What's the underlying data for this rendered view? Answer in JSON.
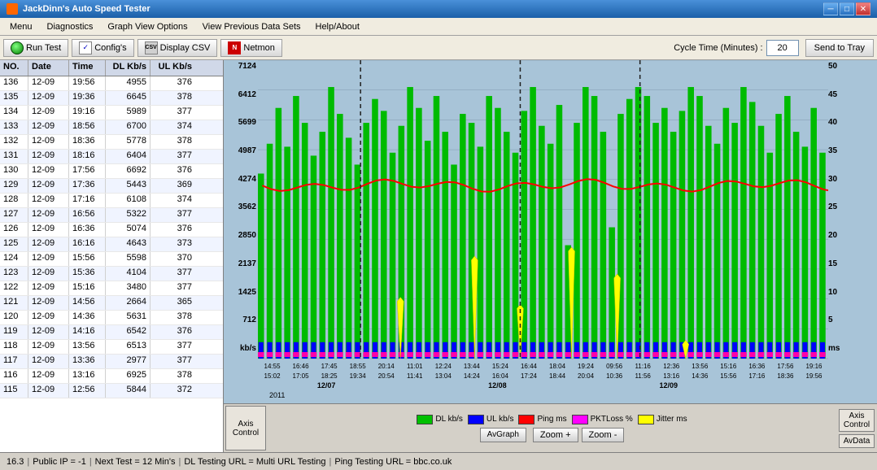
{
  "titlebar": {
    "title": "JackDinn's Auto Speed Tester",
    "controls": {
      "minimize": "─",
      "maximize": "□",
      "close": "✕"
    }
  },
  "menubar": {
    "items": [
      "Menu",
      "Diagnostics",
      "Graph View Options",
      "View Previous Data Sets",
      "Help/About"
    ]
  },
  "toolbar": {
    "run_test": "Run Test",
    "configs": "Config's",
    "display_csv": "Display CSV",
    "netmon": "Netmon",
    "cycle_label": "Cycle Time (Minutes) :",
    "cycle_value": "20",
    "send_tray": "Send to Tray"
  },
  "table": {
    "headers": [
      "NO.",
      "Date",
      "Time",
      "DL Kb/s",
      "UL Kb/s"
    ],
    "rows": [
      {
        "no": "136",
        "date": "12-09",
        "time": "19:56",
        "dl": "4955",
        "ul": "376"
      },
      {
        "no": "135",
        "date": "12-09",
        "time": "19:36",
        "dl": "6645",
        "ul": "378"
      },
      {
        "no": "134",
        "date": "12-09",
        "time": "19:16",
        "dl": "5989",
        "ul": "377"
      },
      {
        "no": "133",
        "date": "12-09",
        "time": "18:56",
        "dl": "6700",
        "ul": "374"
      },
      {
        "no": "132",
        "date": "12-09",
        "time": "18:36",
        "dl": "5778",
        "ul": "378"
      },
      {
        "no": "131",
        "date": "12-09",
        "time": "18:16",
        "dl": "6404",
        "ul": "377"
      },
      {
        "no": "130",
        "date": "12-09",
        "time": "17:56",
        "dl": "6692",
        "ul": "376"
      },
      {
        "no": "129",
        "date": "12-09",
        "time": "17:36",
        "dl": "5443",
        "ul": "369"
      },
      {
        "no": "128",
        "date": "12-09",
        "time": "17:16",
        "dl": "6108",
        "ul": "374"
      },
      {
        "no": "127",
        "date": "12-09",
        "time": "16:56",
        "dl": "5322",
        "ul": "377"
      },
      {
        "no": "126",
        "date": "12-09",
        "time": "16:36",
        "dl": "5074",
        "ul": "376"
      },
      {
        "no": "125",
        "date": "12-09",
        "time": "16:16",
        "dl": "4643",
        "ul": "373"
      },
      {
        "no": "124",
        "date": "12-09",
        "time": "15:56",
        "dl": "5598",
        "ul": "370"
      },
      {
        "no": "123",
        "date": "12-09",
        "time": "15:36",
        "dl": "4104",
        "ul": "377"
      },
      {
        "no": "122",
        "date": "12-09",
        "time": "15:16",
        "dl": "3480",
        "ul": "377"
      },
      {
        "no": "121",
        "date": "12-09",
        "time": "14:56",
        "dl": "2664",
        "ul": "365"
      },
      {
        "no": "120",
        "date": "12-09",
        "time": "14:36",
        "dl": "5631",
        "ul": "378"
      },
      {
        "no": "119",
        "date": "12-09",
        "time": "14:16",
        "dl": "6542",
        "ul": "376"
      },
      {
        "no": "118",
        "date": "12-09",
        "time": "13:56",
        "dl": "6513",
        "ul": "377"
      },
      {
        "no": "117",
        "date": "12-09",
        "time": "13:36",
        "dl": "2977",
        "ul": "377"
      },
      {
        "no": "116",
        "date": "12-09",
        "time": "13:16",
        "dl": "6925",
        "ul": "378"
      },
      {
        "no": "115",
        "date": "12-09",
        "time": "12:56",
        "dl": "5844",
        "ul": "372"
      }
    ]
  },
  "graph": {
    "y_axis_left": [
      "7124",
      "6412",
      "5699",
      "4987",
      "4274",
      "3562",
      "2850",
      "2137",
      "1425",
      "712",
      "kb/s"
    ],
    "y_axis_right": [
      "50",
      "45",
      "40",
      "35",
      "30",
      "25",
      "20",
      "15",
      "10",
      "5",
      "ms"
    ],
    "x_labels_top": [
      "14:55",
      "16:46",
      "17:45",
      "18:55",
      "20:14",
      "11:01",
      "12:24",
      "13:44",
      "15:24",
      "16:44",
      "18:04",
      "19:24",
      "09:56",
      "11:16",
      "12:36",
      "13:56",
      "15:16",
      "16:36",
      "17:56",
      "19:16"
    ],
    "x_labels_mid": [
      "15:02",
      "17:05",
      "18:25",
      "19:34",
      "20:54",
      "11:41",
      "13:04",
      "14:24",
      "16:04",
      "17:24",
      "18:44",
      "20:04",
      "10:36",
      "11:56",
      "13:16",
      "14:36",
      "15:56",
      "17:16",
      "18:36",
      "19:56"
    ],
    "x_dates": [
      "12/07",
      "12/08",
      "12/09"
    ],
    "year": "2011"
  },
  "legend": {
    "items": [
      {
        "label": "DL kb/s",
        "color": "#00c000"
      },
      {
        "label": "UL kb/s",
        "color": "#0000ff"
      },
      {
        "label": "Ping ms",
        "color": "#ff0000"
      },
      {
        "label": "PKTLoss %",
        "color": "#ff00ff"
      },
      {
        "label": "Jitter ms",
        "color": "#ffff00"
      }
    ]
  },
  "controls": {
    "axis_control": "Axis\nControl",
    "av_graph": "AvGraph",
    "zoom_in": "Zoom +",
    "zoom_out": "Zoom -",
    "av_data": "AvData"
  },
  "status": {
    "version": "16.3",
    "public_ip": "Public IP = -1",
    "next_test": "Next Test = 12 Min's",
    "dl_testing": "DL Testing URL = Multi URL Testing",
    "ping_testing": "Ping Testing URL = bbc.co.uk"
  }
}
